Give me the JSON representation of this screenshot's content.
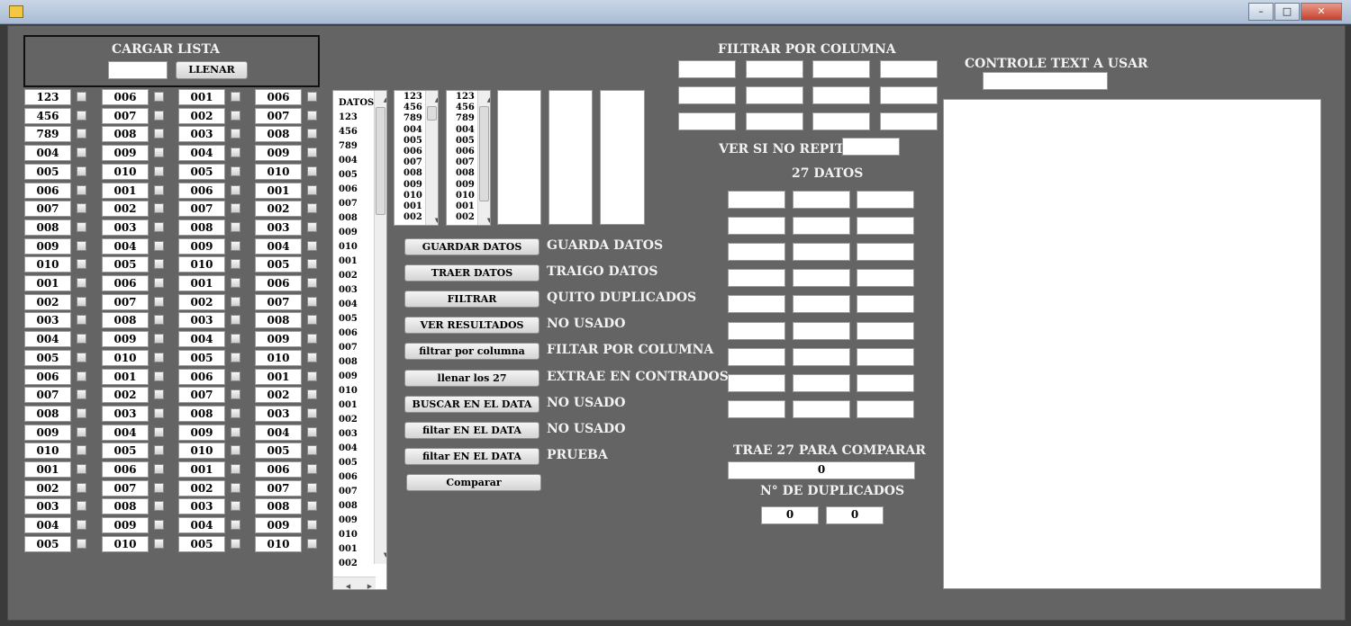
{
  "window": {
    "minimize": "–",
    "maximize": "□",
    "close": "✕"
  },
  "cargar": {
    "title": "CARGAR LISTA",
    "input_value": "",
    "button": "LLENAR"
  },
  "grid": {
    "col1": [
      "123",
      "456",
      "789",
      "004",
      "005",
      "006",
      "007",
      "008",
      "009",
      "010",
      "001",
      "002",
      "003",
      "004",
      "005",
      "006",
      "007",
      "008",
      "009",
      "010",
      "001",
      "002",
      "003",
      "004",
      "005"
    ],
    "col2": [
      "006",
      "007",
      "008",
      "009",
      "010",
      "001",
      "002",
      "003",
      "004",
      "005",
      "006",
      "007",
      "008",
      "009",
      "010",
      "001",
      "002",
      "003",
      "004",
      "005",
      "006",
      "007",
      "008",
      "009",
      "010"
    ],
    "col3": [
      "001",
      "002",
      "003",
      "004",
      "005",
      "006",
      "007",
      "008",
      "009",
      "010",
      "001",
      "002",
      "003",
      "004",
      "005",
      "006",
      "007",
      "008",
      "009",
      "010",
      "001",
      "002",
      "003",
      "004",
      "005"
    ],
    "col4": [
      "006",
      "007",
      "008",
      "009",
      "010",
      "001",
      "002",
      "003",
      "004",
      "005",
      "006",
      "007",
      "008",
      "009",
      "010",
      "001",
      "002",
      "003",
      "004",
      "005",
      "006",
      "007",
      "008",
      "009",
      "010"
    ]
  },
  "datos_list": {
    "header": "DATOS",
    "items": [
      "123",
      "456",
      "789",
      "004",
      "005",
      "006",
      "007",
      "008",
      "009",
      "010",
      "001",
      "002",
      "003",
      "004",
      "005",
      "006",
      "007",
      "008",
      "009",
      "010",
      "001",
      "002",
      "003",
      "004",
      "005",
      "006",
      "007",
      "008",
      "009",
      "010",
      "001",
      "002"
    ]
  },
  "small_list_1": [
    "123",
    "456",
    "789",
    "004",
    "005",
    "006",
    "007",
    "008",
    "009",
    "010",
    "001",
    "002"
  ],
  "small_list_2": [
    "123",
    "456",
    "789",
    "004",
    "005",
    "006",
    "007",
    "008",
    "009",
    "010",
    "001",
    "002"
  ],
  "actions": [
    {
      "button": "GUARDAR DATOS",
      "desc": "GUARDA DATOS"
    },
    {
      "button": "TRAER DATOS",
      "desc": "TRAIGO DATOS"
    },
    {
      "button": "FILTRAR",
      "desc": "QUITO DUPLICADOS"
    },
    {
      "button": "VER RESULTADOS",
      "desc": "NO USADO"
    },
    {
      "button": "filtrar por columna",
      "desc": "FILTAR POR COLUMNA"
    },
    {
      "button": "llenar los 27",
      "desc": "EXTRAE EN CONTRADOS"
    },
    {
      "button": "BUSCAR EN EL DATA",
      "desc": "NO USADO"
    },
    {
      "button": "filtar EN EL DATA",
      "desc": "NO USADO"
    },
    {
      "button": "filtar EN EL DATA",
      "desc": "PRUEBA"
    },
    {
      "button": "Comparar",
      "desc": ""
    }
  ],
  "filtrar_columna": {
    "title": "FILTRAR POR COLUMNA"
  },
  "ver_si_no_repite": {
    "label": "VER SI NO REPITE",
    "value": ""
  },
  "datos27": {
    "title": "27 DATOS"
  },
  "trae27": {
    "label": "TRAE 27 PARA COMPARAR",
    "value": "0"
  },
  "duplicados": {
    "label": "N° DE DUPLICADOS",
    "value1": "0",
    "value2": "0"
  },
  "controle": {
    "label": "CONTROLE TEXT A USAR",
    "value": ""
  }
}
